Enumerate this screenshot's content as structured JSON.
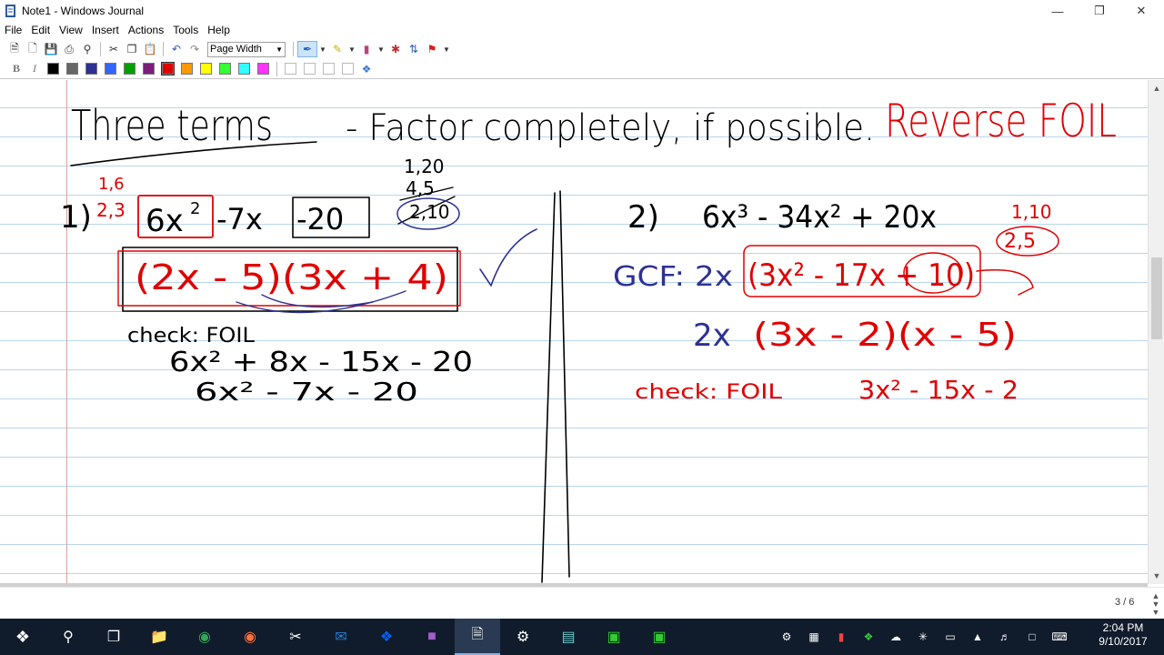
{
  "window": {
    "title": "Note1 - Windows Journal"
  },
  "menu": [
    "File",
    "Edit",
    "View",
    "Insert",
    "Actions",
    "Tools",
    "Help"
  ],
  "toolbar": {
    "zoom_value": "Page Width"
  },
  "ink_colors": [
    "#000000",
    "#666666",
    "#2e3192",
    "#3366ff",
    "#00a000",
    "#7a1f7a",
    "#e00000",
    "#ff9900",
    "#ffff00",
    "#33ff33",
    "#33ffff",
    "#ff33ff"
  ],
  "accent": {
    "red_ink": "#e00000",
    "black_ink": "#000000",
    "rule_line": "#b9d6ec",
    "margin_line": "#d8a0a0"
  },
  "note": {
    "heading": "Three terms",
    "subheading": "- Factor completely, if possible.",
    "heading_red": "Reverse FOIL",
    "p1_num": "1)",
    "p1_pairs": "1,6",
    "p1_pairs2": "2,3",
    "p1_expr_a": "6x",
    "p1_expr_b": "-7x",
    "p1_expr_c": "-20",
    "p1_f1": "1,20",
    "p1_f2": "4,5",
    "p1_f3": "2,10",
    "p1_answer": "(2x - 5)(3x + 4)",
    "p1_check": "check: FOIL",
    "p1_line1": "6x² + 8x - 15x - 20",
    "p1_line2": "6x² - 7x - 20",
    "p2_num": "2)",
    "p2_expr": "6x³ - 34x² + 20x",
    "p2_f1": "1,10",
    "p2_f2": "2,5",
    "p2_gcf": "GCF: 2x",
    "p2_inner": "(3x² - 17x + 10)",
    "p2_result_a": "2x",
    "p2_result_b": "(3x - 2)(x - 5)",
    "p2_check": "check: FOIL",
    "p2_check_line": "3x² - 15x - 2"
  },
  "status": {
    "page": "3 / 6"
  },
  "clock": {
    "time": "2:04 PM",
    "date": "9/10/2017"
  }
}
